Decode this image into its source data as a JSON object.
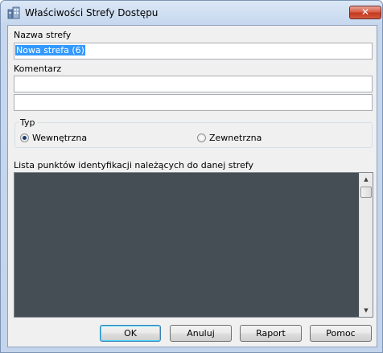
{
  "window": {
    "title": "Właściwości Strefy Dostępu",
    "close_symbol": "✕"
  },
  "form": {
    "zone_name_label": "Nazwa strefy",
    "zone_name_value": "Nowa strefa (6)",
    "comment_label": "Komentarz",
    "comment_line1": "",
    "comment_line2": ""
  },
  "type_group": {
    "label": "Typ",
    "options": [
      {
        "label": "Wewnętrzna",
        "selected": true
      },
      {
        "label": "Zewnetrzna",
        "selected": false
      }
    ]
  },
  "list": {
    "label": "Lista punktów identyfikacji należących do danej strefy",
    "items": []
  },
  "buttons": {
    "ok": "OK",
    "cancel": "Anuluj",
    "report": "Raport",
    "help": "Pomoc"
  }
}
